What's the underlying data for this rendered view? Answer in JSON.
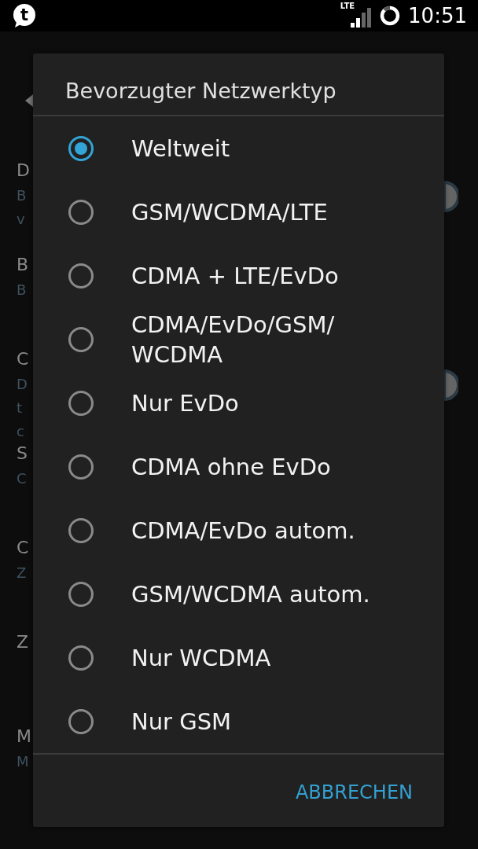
{
  "status_bar": {
    "app_icon_text": "t",
    "network_type": "LTE",
    "time": "10:51"
  },
  "background": {
    "items": [
      {
        "title": "D",
        "summary": [
          "B",
          "v"
        ],
        "toggle": true
      },
      {
        "title": "B",
        "summary": [
          "B"
        ]
      },
      {
        "title": "C",
        "summary": [
          "D",
          "t",
          "c"
        ],
        "toggle": true
      },
      {
        "title": "S",
        "summary": [
          "C"
        ]
      },
      {
        "title": "C",
        "summary": [
          "Z"
        ]
      },
      {
        "title": "Z"
      },
      {
        "title": "M",
        "summary": [
          "M"
        ]
      }
    ]
  },
  "dialog": {
    "title": "Bevorzugter Netzwerktyp",
    "options": [
      {
        "label": "Weltweit",
        "selected": true
      },
      {
        "label": "GSM/WCDMA/LTE",
        "selected": false
      },
      {
        "label": "CDMA + LTE/EvDo",
        "selected": false
      },
      {
        "label": "CDMA/EvDo/GSM/WCDMA",
        "selected": false
      },
      {
        "label": "Nur EvDo",
        "selected": false
      },
      {
        "label": "CDMA ohne EvDo",
        "selected": false
      },
      {
        "label": "CDMA/EvDo autom.",
        "selected": false
      },
      {
        "label": "GSM/WCDMA autom.",
        "selected": false
      },
      {
        "label": "Nur WCDMA",
        "selected": false
      },
      {
        "label": "Nur GSM",
        "selected": false
      }
    ],
    "cancel_button": "ABBRECHEN"
  }
}
